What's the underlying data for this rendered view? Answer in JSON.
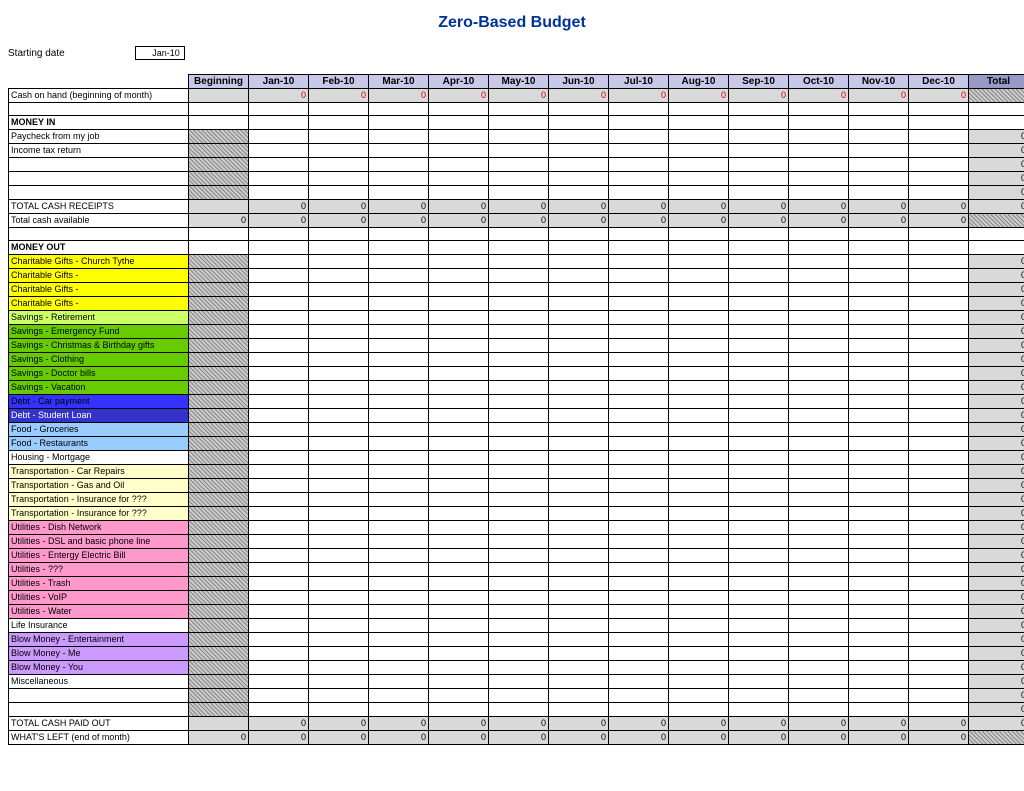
{
  "title": "Zero-Based Budget",
  "starting": {
    "label": "Starting date",
    "value": "Jan-10"
  },
  "columns": [
    "Beginning",
    "Jan-10",
    "Feb-10",
    "Mar-10",
    "Apr-10",
    "May-10",
    "Jun-10",
    "Jul-10",
    "Aug-10",
    "Sep-10",
    "Oct-10",
    "Nov-10",
    "Dec-10",
    "Total"
  ],
  "cash_on_hand": {
    "label": "Cash on hand (beginning of month)",
    "values": [
      "",
      "0",
      "0",
      "0",
      "0",
      "0",
      "0",
      "0",
      "0",
      "0",
      "0",
      "0",
      "0",
      ""
    ]
  },
  "money_in": {
    "header": "MONEY IN",
    "rows": [
      {
        "label": "Paycheck from my job",
        "total": "0"
      },
      {
        "label": "Income tax return",
        "total": "0"
      },
      {
        "label": "",
        "total": "0"
      },
      {
        "label": "",
        "total": "0"
      },
      {
        "label": "",
        "total": "0"
      }
    ],
    "total_receipts": {
      "label": "TOTAL CASH RECEIPTS",
      "values": [
        "",
        "0",
        "0",
        "0",
        "0",
        "0",
        "0",
        "0",
        "0",
        "0",
        "0",
        "0",
        "0",
        "0"
      ]
    },
    "total_available": {
      "label": "Total cash available",
      "values": [
        "0",
        "0",
        "0",
        "0",
        "0",
        "0",
        "0",
        "0",
        "0",
        "0",
        "0",
        "0",
        "0",
        ""
      ]
    }
  },
  "money_out": {
    "header": "MONEY OUT",
    "rows": [
      {
        "label": "Charitable Gifts - Church Tythe",
        "color": "c-yellow",
        "total": "0"
      },
      {
        "label": "Charitable Gifts -",
        "color": "c-yellow",
        "total": "0"
      },
      {
        "label": "Charitable Gifts -",
        "color": "c-yellow",
        "total": "0"
      },
      {
        "label": "Charitable Gifts -",
        "color": "c-yellow",
        "total": "0"
      },
      {
        "label": "Savings - Retirement",
        "color": "c-yellowgrn",
        "total": "0"
      },
      {
        "label": "Savings - Emergency Fund",
        "color": "c-green",
        "total": "0"
      },
      {
        "label": "Savings - Christmas & Birthday gifts",
        "color": "c-green",
        "total": "0"
      },
      {
        "label": "Savings - Clothing",
        "color": "c-green",
        "total": "0"
      },
      {
        "label": "Savings - Doctor bills",
        "color": "c-green",
        "total": "0"
      },
      {
        "label": "Savings - Vacation",
        "color": "c-green",
        "total": "0"
      },
      {
        "label": "Debt - Car payment",
        "color": "c-blue",
        "total": "0"
      },
      {
        "label": "Debt - Student Loan",
        "color": "c-darkblue",
        "total": "0"
      },
      {
        "label": "Food - Groceries",
        "color": "c-lightblue",
        "total": "0"
      },
      {
        "label": "Food - Restaurants",
        "color": "c-lightblue",
        "total": "0"
      },
      {
        "label": "Housing - Mortgage",
        "color": "c-white",
        "total": "0"
      },
      {
        "label": "Transportation - Car Repairs",
        "color": "c-paleyel",
        "total": "0"
      },
      {
        "label": "Transportation - Gas and Oil",
        "color": "c-paleyel",
        "total": "0"
      },
      {
        "label": "Transportation - Insurance for ???",
        "color": "c-paleyel",
        "total": "0"
      },
      {
        "label": "Transportation - Insurance for ???",
        "color": "c-paleyel",
        "total": "0"
      },
      {
        "label": "Utilities - Dish Network",
        "color": "c-pink",
        "total": "0"
      },
      {
        "label": "Utilities - DSL and basic phone line",
        "color": "c-pink",
        "total": "0"
      },
      {
        "label": "Utilities - Entergy Electric Bill",
        "color": "c-pink",
        "total": "0"
      },
      {
        "label": "Utilities - ???",
        "color": "c-pink",
        "total": "0"
      },
      {
        "label": "Utilities - Trash",
        "color": "c-pink",
        "total": "0"
      },
      {
        "label": "Utilities - VoIP",
        "color": "c-pink",
        "total": "0"
      },
      {
        "label": "Utilities - Water",
        "color": "c-pink",
        "total": "0"
      },
      {
        "label": "Life Insurance",
        "color": "c-white",
        "total": "0"
      },
      {
        "label": "Blow Money - Entertainment",
        "color": "c-purple",
        "total": "0"
      },
      {
        "label": "Blow Money - Me",
        "color": "c-purple",
        "total": "0"
      },
      {
        "label": "Blow Money - You",
        "color": "c-purple",
        "total": "0"
      },
      {
        "label": "Miscellaneous",
        "color": "c-white",
        "total": "0"
      },
      {
        "label": "",
        "color": "c-white",
        "total": "0"
      },
      {
        "label": "",
        "color": "c-white",
        "total": "0"
      }
    ],
    "total_paid": {
      "label": "TOTAL CASH PAID OUT",
      "values": [
        "",
        "0",
        "0",
        "0",
        "0",
        "0",
        "0",
        "0",
        "0",
        "0",
        "0",
        "0",
        "0",
        "0"
      ]
    },
    "whats_left": {
      "label": "WHAT'S LEFT (end of month)",
      "values": [
        "0",
        "0",
        "0",
        "0",
        "0",
        "0",
        "0",
        "0",
        "0",
        "0",
        "0",
        "0",
        "0",
        ""
      ]
    }
  }
}
